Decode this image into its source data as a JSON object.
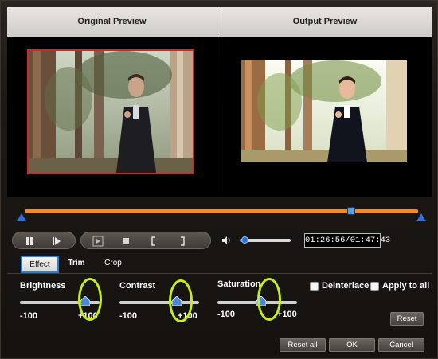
{
  "preview": {
    "original_title": "Original Preview",
    "output_title": "Output Preview"
  },
  "timeline": {
    "playhead_fraction": 0.83
  },
  "playback": {
    "time_display": "01:26:56/01:47:43",
    "volume_fraction": 0.1
  },
  "tabs": [
    {
      "label": "Effect",
      "active": true
    },
    {
      "label": "Trim",
      "active": false
    },
    {
      "label": "Crop",
      "active": false
    }
  ],
  "effects": {
    "brightness": {
      "label": "Brightness",
      "min_label": "-100",
      "max_label": "+100",
      "value_fraction": 0.82
    },
    "contrast": {
      "label": "Contrast",
      "min_label": "-100",
      "max_label": "+100",
      "value_fraction": 0.72
    },
    "saturation": {
      "label": "Saturation",
      "min_label": "-100",
      "max_label": "+100",
      "value_fraction": 0.55
    }
  },
  "options": {
    "deinterlace": {
      "label": "Deinterlace",
      "checked": false
    },
    "apply_to_all": {
      "label": "Apply to all",
      "checked": false
    }
  },
  "buttons": {
    "reset": "Reset",
    "reset_all": "Reset all",
    "ok": "OK",
    "cancel": "Cancel"
  },
  "colors": {
    "accent_blue": "#1e7fe0",
    "timeline_orange": "#f08a2a",
    "highlight_circle": "#c6ee1b",
    "selection_red": "#cc2a2a"
  }
}
